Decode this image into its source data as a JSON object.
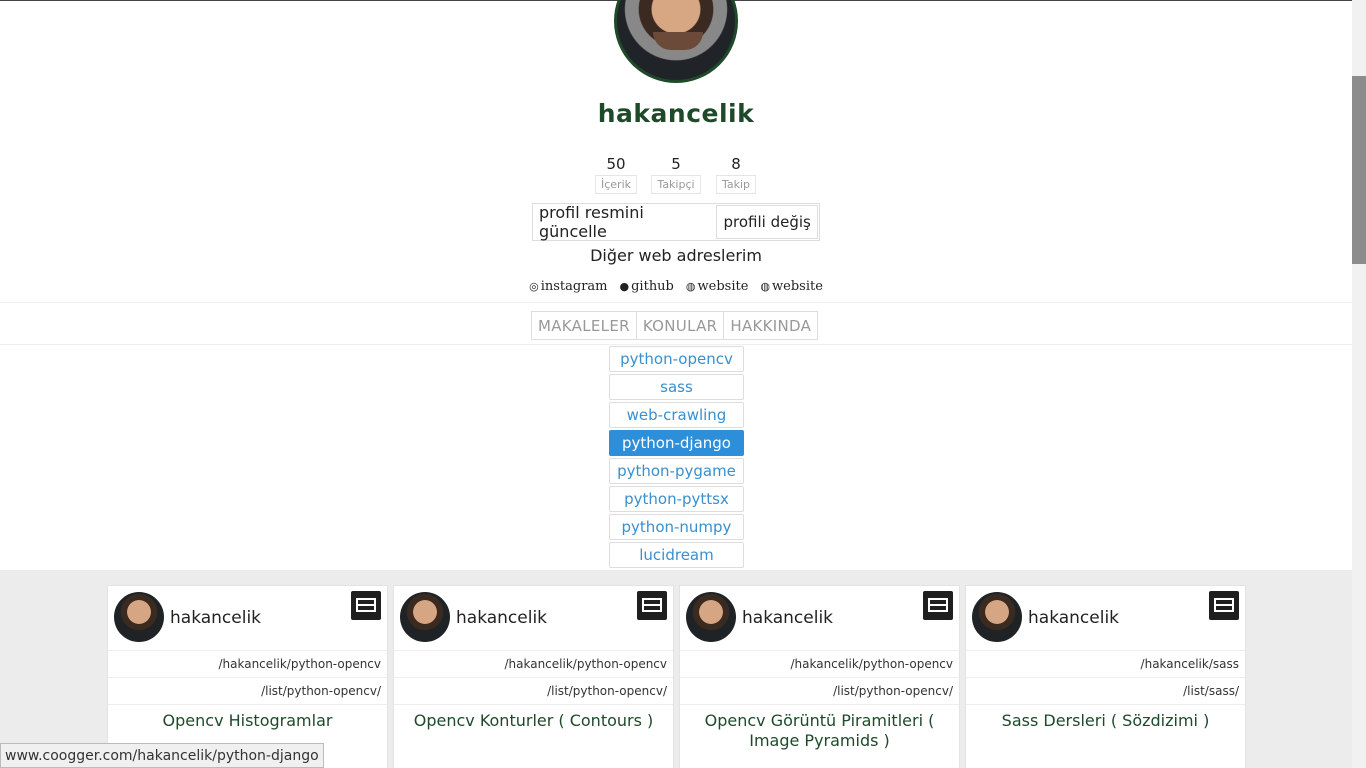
{
  "profile": {
    "username": "hakancelik",
    "stats": [
      {
        "value": "50",
        "label": "İçerik"
      },
      {
        "value": "5",
        "label": "Takipçi"
      },
      {
        "value": "8",
        "label": "Takip"
      }
    ],
    "update_photo_label": "profil resmini güncelle",
    "edit_profile_label": "profili değiş",
    "web_title": "Diğer web adreslerim",
    "links": [
      {
        "icon": "instagram-icon",
        "label": "instagram"
      },
      {
        "icon": "github-icon",
        "label": "github"
      },
      {
        "icon": "globe-icon",
        "label": "website"
      },
      {
        "icon": "globe-icon",
        "label": "website"
      }
    ],
    "tabs": [
      "MAKALELER",
      "KONULAR",
      "HAKKINDA"
    ],
    "topics": [
      "python-opencv",
      "sass",
      "web-crawling",
      "python-django",
      "python-pygame",
      "python-pyttsx",
      "python-numpy",
      "lucidream"
    ],
    "active_topic": "python-django"
  },
  "cards": [
    {
      "user": "hakancelik",
      "path": "/hakancelik/python-opencv",
      "list": "/list/python-opencv/",
      "title": "Opencv Histogramlar"
    },
    {
      "user": "hakancelik",
      "path": "/hakancelik/python-opencv",
      "list": "/list/python-opencv/",
      "title": "Opencv Konturler ( Contours )"
    },
    {
      "user": "hakancelik",
      "path": "/hakancelik/python-opencv",
      "list": "/list/python-opencv/",
      "title": "Opencv Görüntü Piramitleri ( Image Pyramids )"
    },
    {
      "user": "hakancelik",
      "path": "/hakancelik/sass",
      "list": "/list/sass/",
      "title": "Sass Dersleri ( Sözdizimi )"
    }
  ],
  "status_url": "www.coogger.com/hakancelik/python-django",
  "colors": {
    "accent_green": "#1e4a2a",
    "topic_blue": "#3a8fce",
    "active_blue": "#2d8fd9"
  }
}
